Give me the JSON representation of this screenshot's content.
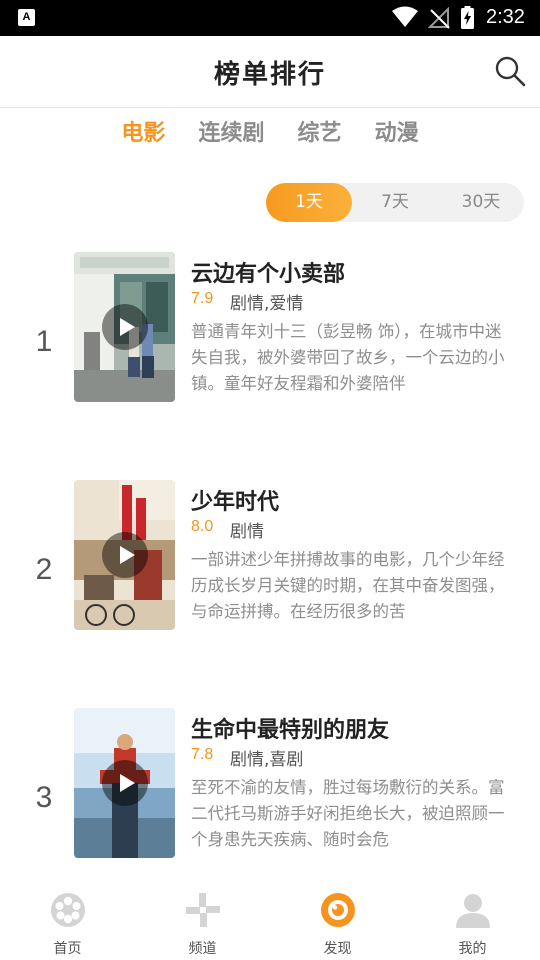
{
  "status_bar": {
    "app_icon_glyph": "A",
    "time": "2:32"
  },
  "header": {
    "title": "榜单排行"
  },
  "category_tabs": [
    {
      "label": "电影",
      "active": true
    },
    {
      "label": "连续剧",
      "active": false
    },
    {
      "label": "综艺",
      "active": false
    },
    {
      "label": "动漫",
      "active": false
    }
  ],
  "period_toggle": [
    {
      "label": "1天",
      "active": true
    },
    {
      "label": "7天",
      "active": false
    },
    {
      "label": "30天",
      "active": false
    }
  ],
  "rankings": [
    {
      "rank": "1",
      "title": "云边有个小卖部",
      "score": "7.9",
      "genre": "剧情,爱情",
      "description": "普通青年刘十三（彭昱畅 饰），在城市中迷失自我，被外婆带回了故乡，一个云边的小镇。童年好友程霜和外婆陪伴"
    },
    {
      "rank": "2",
      "title": "少年时代",
      "score": "8.0",
      "genre": "剧情",
      "description": "一部讲述少年拼搏故事的电影，几个少年经历成长岁月关键的时期，在其中奋发图强，与命运拼搏。在经历很多的苦"
    },
    {
      "rank": "3",
      "title": "生命中最特别的朋友",
      "score": "7.8",
      "genre": "剧情,喜剧",
      "description": "至死不渝的友情，胜过每场敷衍的关系。富二代托马斯游手好闲拒绝长大，被迫照顾一个身患先天疾病、随时会危"
    }
  ],
  "bottom_nav": [
    {
      "label": "首页",
      "icon": "film-reel-icon"
    },
    {
      "label": "频道",
      "icon": "channel-pinwheel-icon"
    },
    {
      "label": "发现",
      "icon": "discover-icon",
      "active": true
    },
    {
      "label": "我的",
      "icon": "profile-icon"
    }
  ],
  "colors": {
    "accent": "#f7931e",
    "inactive_tab": "#8c8c8c",
    "icon_grey": "#d4d4d4"
  }
}
